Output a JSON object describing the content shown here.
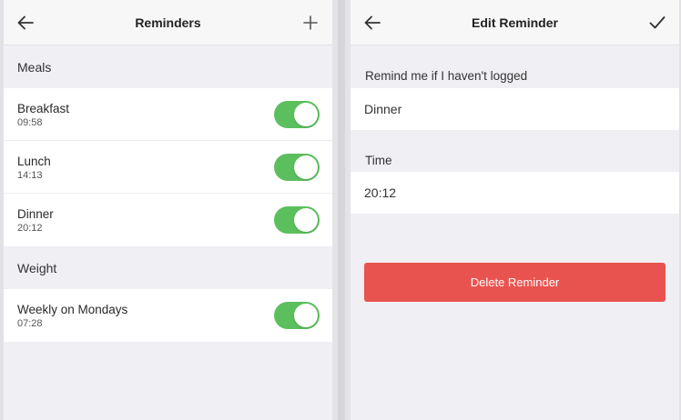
{
  "reminders_screen": {
    "title": "Reminders",
    "back_icon": "arrow-left-icon",
    "add_icon": "plus-icon",
    "sections": [
      {
        "label": "Meals",
        "items": [
          {
            "name": "Breakfast",
            "time": "09:58",
            "enabled": true
          },
          {
            "name": "Lunch",
            "time": "14:13",
            "enabled": true
          },
          {
            "name": "Dinner",
            "time": "20:12",
            "enabled": true
          }
        ]
      },
      {
        "label": "Weight",
        "items": [
          {
            "name": "Weekly on Mondays",
            "time": "07:28",
            "enabled": true
          }
        ]
      }
    ]
  },
  "edit_screen": {
    "title": "Edit Reminder",
    "back_icon": "arrow-left-icon",
    "confirm_icon": "checkmark-icon",
    "remind_label": "Remind me if I haven't logged",
    "remind_value": "Dinner",
    "time_label": "Time",
    "time_value": "20:12",
    "delete_label": "Delete Reminder"
  },
  "colors": {
    "toggle_on": "#5cbf5e",
    "delete": "#e9534f",
    "background": "#efeff4"
  }
}
